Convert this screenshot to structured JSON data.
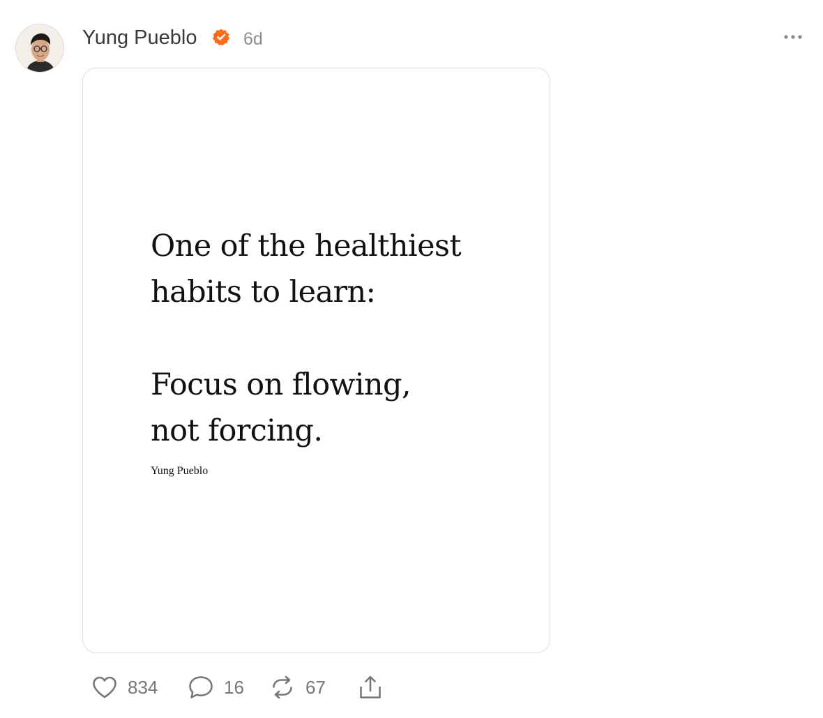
{
  "post": {
    "author": "Yung Pueblo",
    "time": "6d",
    "verified_icon": "verified-badge-icon",
    "verified_color": "#FF6B16",
    "image": {
      "quote_lines": [
        "One of the healthiest",
        "habits to learn:",
        "Focus on flowing,",
        "not forcing."
      ],
      "signature": "Yung Pueblo"
    }
  },
  "actions": {
    "likes": "834",
    "comments": "16",
    "reposts": "67"
  },
  "icons": {
    "like": "heart-icon",
    "comment": "comment-bubble-icon",
    "repost": "repost-arrows-icon",
    "share": "share-upload-icon",
    "more": "more-options-icon"
  }
}
